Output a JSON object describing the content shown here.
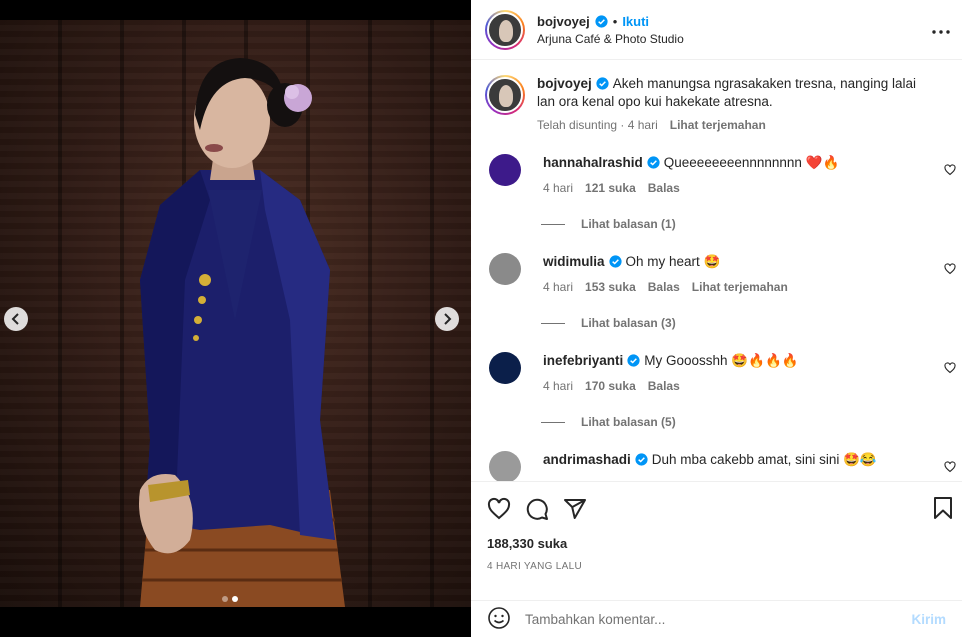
{
  "header": {
    "username": "bojvoyej",
    "separator": "•",
    "follow_label": "Ikuti",
    "location": "Arjuna Café & Photo Studio",
    "more_icon": "more-horizontal-icon"
  },
  "media": {
    "slide_count": 2,
    "current_slide": 2,
    "prev_icon": "chevron-left-icon",
    "next_icon": "chevron-right-icon"
  },
  "caption": {
    "username": "bojvoyej",
    "text": "Akeh manungsa ngrasakaken tresna, nanging lalai lan ora kenal opo kui hakekate atresna.",
    "edited": "Telah disunting",
    "time": "4 hari",
    "translate": "Lihat terjemahan"
  },
  "comments": [
    {
      "username": "hannahalrashid",
      "text": "Queeeeeeeennnnnnnn ❤️🔥",
      "time": "4 hari",
      "likes": "121 suka",
      "reply": "Balas",
      "translate": "",
      "view_replies": "Lihat balasan (1)",
      "avatar_color": "#3d1a8a"
    },
    {
      "username": "widimulia",
      "text": "Oh my heart 🤩",
      "time": "4 hari",
      "likes": "153 suka",
      "reply": "Balas",
      "translate": "Lihat terjemahan",
      "view_replies": "Lihat balasan (3)",
      "avatar_color": "#8a8a8a"
    },
    {
      "username": "inefebriyanti",
      "text": "My Gooosshh 🤩🔥🔥🔥",
      "time": "4 hari",
      "likes": "170 suka",
      "reply": "Balas",
      "translate": "",
      "view_replies": "Lihat balasan (5)",
      "avatar_color": "#0b1f4a"
    },
    {
      "username": "andrimashadi",
      "text": "Duh mba cakebb amat, sini sini 🤩😂",
      "time": "",
      "likes": "",
      "reply": "",
      "translate": "",
      "view_replies": "",
      "avatar_color": "#9a9a9a"
    }
  ],
  "actions": {
    "like_icon": "heart-icon",
    "comment_icon": "comment-icon",
    "share_icon": "send-icon",
    "save_icon": "bookmark-icon",
    "likes_count": "188,330 suka",
    "date": "4 HARI YANG LALU"
  },
  "add_comment": {
    "emoji_icon": "emoji-icon",
    "placeholder": "Tambahkan komentar...",
    "post_label": "Kirim"
  },
  "colors": {
    "accent": "#0095f6",
    "post_disabled": "#b3dbff",
    "muted": "#737373",
    "text": "#262626"
  }
}
